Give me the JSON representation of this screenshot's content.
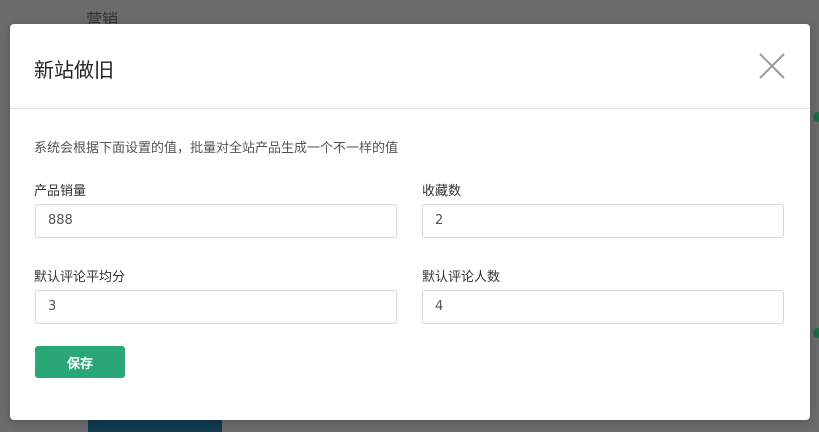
{
  "background": {
    "text": "营销",
    "accent_color": "#1b6b46"
  },
  "modal": {
    "title": "新站做旧",
    "close_icon": "close-icon",
    "hint": "系统会根据下面设置的值，批量对全站产品生成一个不一样的值",
    "fields": [
      {
        "label": "产品销量",
        "value": "888"
      },
      {
        "label": "收藏数",
        "value": "2"
      },
      {
        "label": "默认评论平均分",
        "value": "3"
      },
      {
        "label": "默认评论人数",
        "value": "4"
      }
    ],
    "save_label": "保存",
    "save_color": "#2aa776"
  }
}
